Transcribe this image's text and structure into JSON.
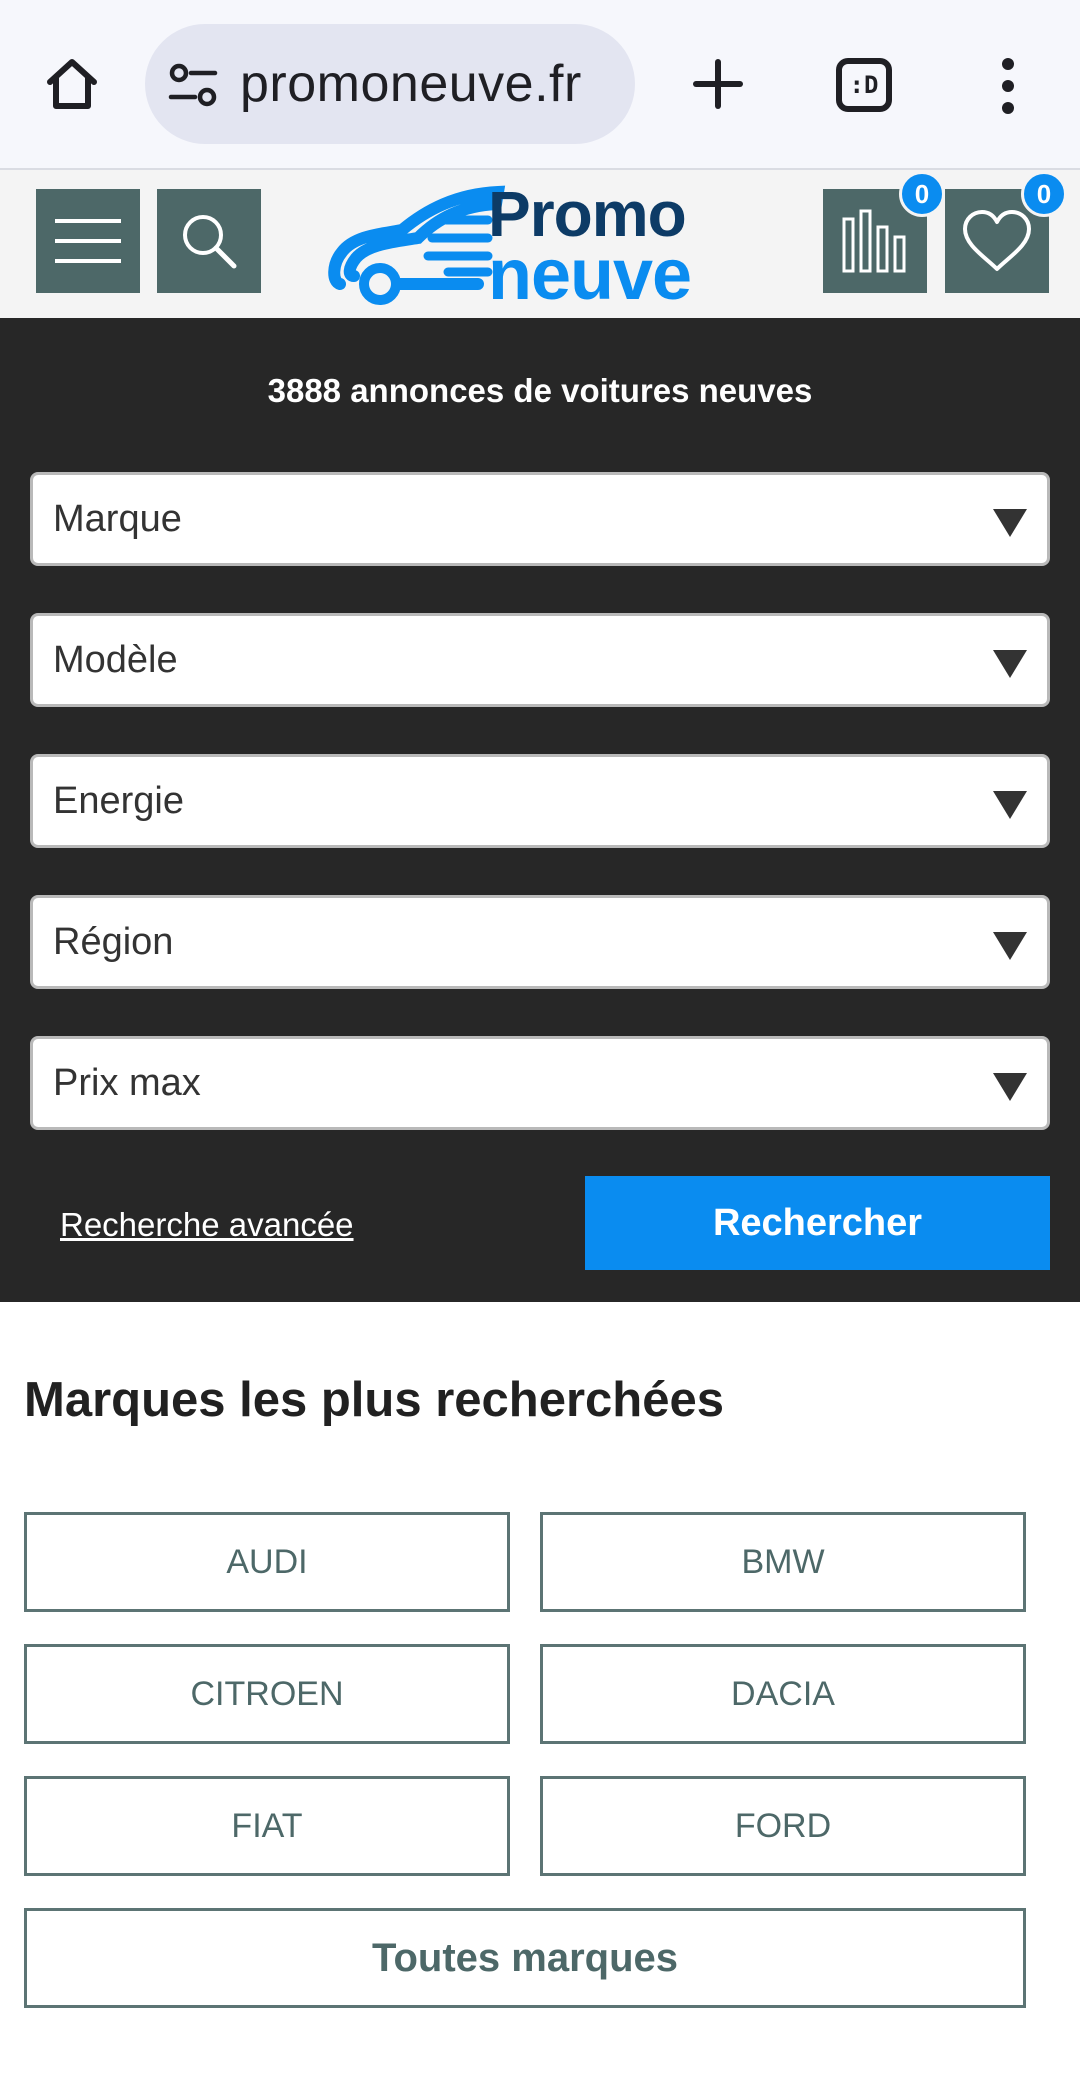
{
  "browser": {
    "url": "promoneuve.fr",
    "tab_switcher_label": ":D"
  },
  "header": {
    "logo_line1": "Promo",
    "logo_line2": "neuve",
    "compare_count": "0",
    "favorites_count": "0"
  },
  "search": {
    "listing_count_text": "3888 annonces de voitures neuves",
    "selects": [
      {
        "label": "Marque"
      },
      {
        "label": "Modèle"
      },
      {
        "label": "Energie"
      },
      {
        "label": "Région"
      },
      {
        "label": "Prix max"
      }
    ],
    "advanced_link": "Recherche avancée",
    "submit_label": "Rechercher"
  },
  "brands": {
    "title": "Marques les plus recherchées",
    "items": [
      "AUDI",
      "BMW",
      "CITROEN",
      "DACIA",
      "FIAT",
      "FORD"
    ],
    "all_label": "Toutes marques"
  },
  "colors": {
    "accent_blue": "#0a8cf0",
    "logo_navy": "#0d3b66",
    "header_button_teal": "#4d6868",
    "search_panel_bg": "#272727"
  }
}
